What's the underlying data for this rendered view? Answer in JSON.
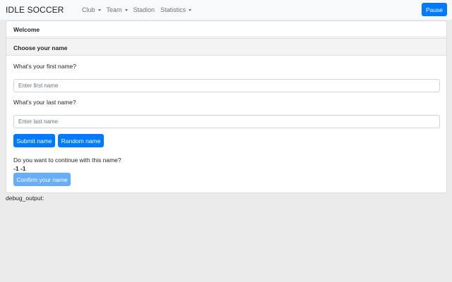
{
  "navbar": {
    "brand": "IDLE SOCCER",
    "items": [
      {
        "label": "Club",
        "dropdown": true
      },
      {
        "label": "Team",
        "dropdown": true
      },
      {
        "label": "Stadion",
        "dropdown": false
      },
      {
        "label": "Statistics",
        "dropdown": true
      }
    ],
    "pause_label": "Pause"
  },
  "card": {
    "welcome": "Welcome",
    "section_title": "Choose your name",
    "first_name_question": "What's your first name?",
    "first_name_placeholder": "Enter first name",
    "last_name_question": "What's your last name?",
    "last_name_placeholder": "Enter last name",
    "submit_label": "Submit name",
    "random_label": "Random name",
    "continue_question": "Do you want to continue with this name?",
    "current_values": "-1 -1",
    "confirm_label": "Confirm your name"
  },
  "debug": {
    "label": "debug_output:"
  },
  "colors": {
    "primary": "#007bff",
    "primary_disabled": "#66aefc",
    "navbar_bg": "#f8f9fa",
    "page_bg": "#ebebeb"
  }
}
